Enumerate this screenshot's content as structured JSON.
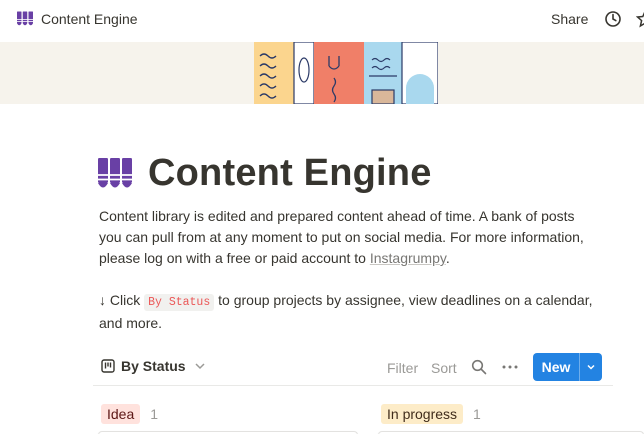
{
  "topbar": {
    "breadcrumb_title": "Content Engine",
    "share_label": "Share"
  },
  "page": {
    "title": "Content Engine",
    "description": "Content library is edited and prepared content ahead of time. A bank of posts you can pull from at any moment to put on social media. For more information, please log on with a free or paid account to ",
    "link_text": "Instagrumpy",
    "description_end": ".",
    "hint_prefix": "↓ Click ",
    "hint_code": "By Status",
    "hint_suffix": " to group projects by assignee, view deadlines on a calendar, and more."
  },
  "view": {
    "tab_label": "By Status",
    "filter_label": "Filter",
    "sort_label": "Sort",
    "new_label": "New"
  },
  "groups": [
    {
      "label": "Idea",
      "count": "1",
      "tag_bg": "#ffe2dd",
      "tag_color": "#5d1715"
    },
    {
      "label": "In progress",
      "count": "1",
      "tag_bg": "#fdecc8",
      "tag_color": "#402c1b"
    }
  ],
  "colors": {
    "accent": "#2383e2",
    "icon_purple": "#6940a5"
  }
}
